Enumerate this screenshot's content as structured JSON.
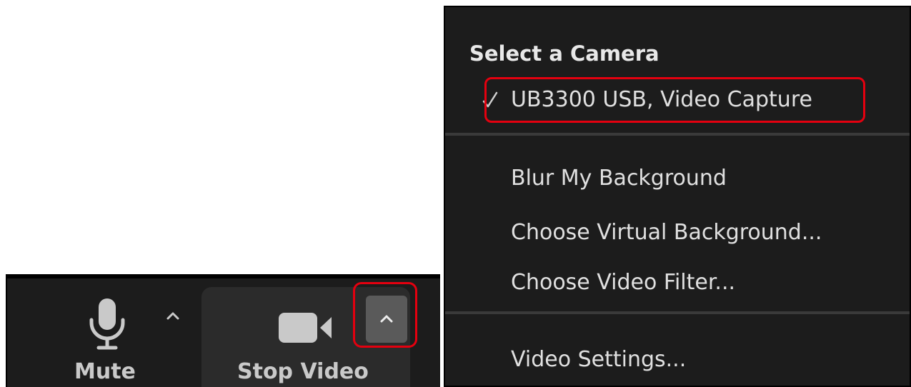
{
  "toolbar": {
    "mute_label": "Mute",
    "video_label": "Stop Video",
    "icons": {
      "mic": "microphone-icon",
      "camera": "video-camera-icon",
      "audio_caret": "chevron-up-icon",
      "video_caret": "chevron-up-icon"
    }
  },
  "menu": {
    "heading": "Select a Camera",
    "camera_item": "UB3300 USB, Video Capture",
    "camera_selected": true,
    "blur_item": "Blur My Background",
    "virtual_item": "Choose Virtual Background...",
    "filter_item": "Choose Video Filter...",
    "settings_item": "Video Settings..."
  },
  "colors": {
    "panel_bg": "#1c1c1c",
    "video_tool_bg": "#2b2b2b",
    "caret_button_bg": "#5a5a5a",
    "text": "#e0e0e0",
    "toolbar_text": "#c9c9c9",
    "highlight": "#e4000f",
    "divider": "#3a3a3a"
  }
}
